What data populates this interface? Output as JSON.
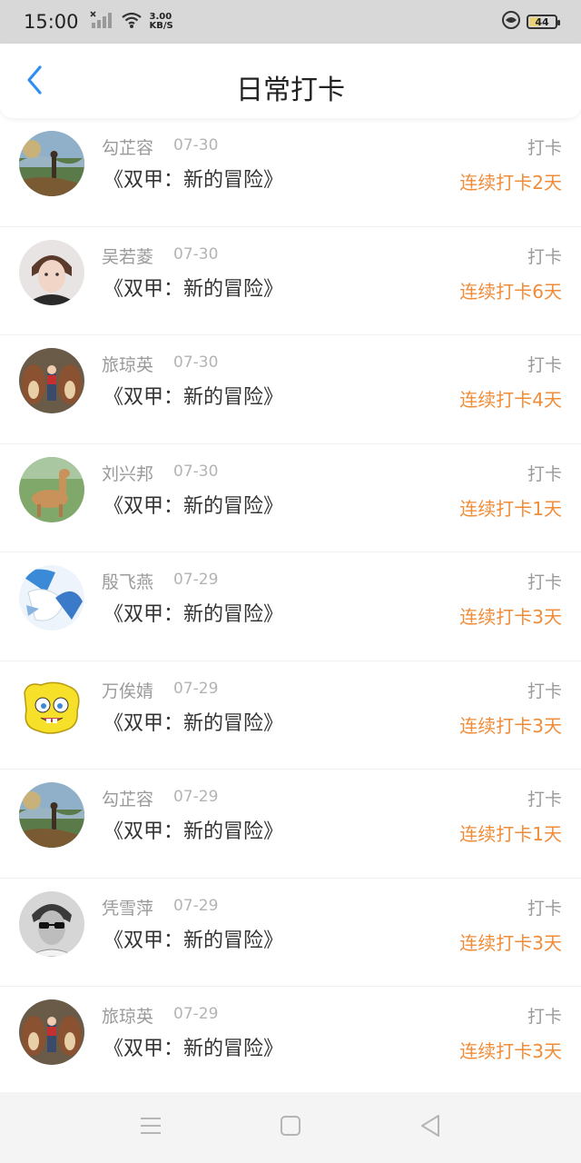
{
  "status_bar": {
    "time": "15:00",
    "speed_value": "3.00",
    "speed_unit": "KB/S",
    "battery": "44",
    "battery_level": 0.44
  },
  "header": {
    "title": "日常打卡"
  },
  "items": [
    {
      "name": "勾芷容",
      "date": "07-30",
      "book": "《双甲：新的冒险》",
      "action": "打卡",
      "streak": "连续打卡2天",
      "avatar": "landscape-avatar"
    },
    {
      "name": "吴若菱",
      "date": "07-30",
      "book": "《双甲：新的冒险》",
      "action": "打卡",
      "streak": "连续打卡6天",
      "avatar": "person-avatar"
    },
    {
      "name": "旅琼英",
      "date": "07-30",
      "book": "《双甲：新的冒险》",
      "action": "打卡",
      "streak": "连续打卡4天",
      "avatar": "chipmunks-avatar"
    },
    {
      "name": "刘兴邦",
      "date": "07-30",
      "book": "《双甲：新的冒险》",
      "action": "打卡",
      "streak": "连续打卡1天",
      "avatar": "alpaca-avatar"
    },
    {
      "name": "殷飞燕",
      "date": "07-29",
      "book": "《双甲：新的冒险》",
      "action": "打卡",
      "streak": "连续打卡3天",
      "avatar": "bird-avatar"
    },
    {
      "name": "万俟婧",
      "date": "07-29",
      "book": "《双甲：新的冒险》",
      "action": "打卡",
      "streak": "连续打卡3天",
      "avatar": "sponge-avatar"
    },
    {
      "name": "勾芷容",
      "date": "07-29",
      "book": "《双甲：新的冒险》",
      "action": "打卡",
      "streak": "连续打卡1天",
      "avatar": "landscape-avatar"
    },
    {
      "name": "凭雪萍",
      "date": "07-29",
      "book": "《双甲：新的冒险》",
      "action": "打卡",
      "streak": "连续打卡3天",
      "avatar": "sunglasses-avatar"
    },
    {
      "name": "旅琼英",
      "date": "07-29",
      "book": "《双甲：新的冒险》",
      "action": "打卡",
      "streak": "连续打卡3天",
      "avatar": "chipmunks-avatar"
    }
  ],
  "colors": {
    "accent_blue": "#2f8ff0",
    "streak_orange": "#f08c38",
    "status_bar_bg": "#d8d8d8"
  }
}
